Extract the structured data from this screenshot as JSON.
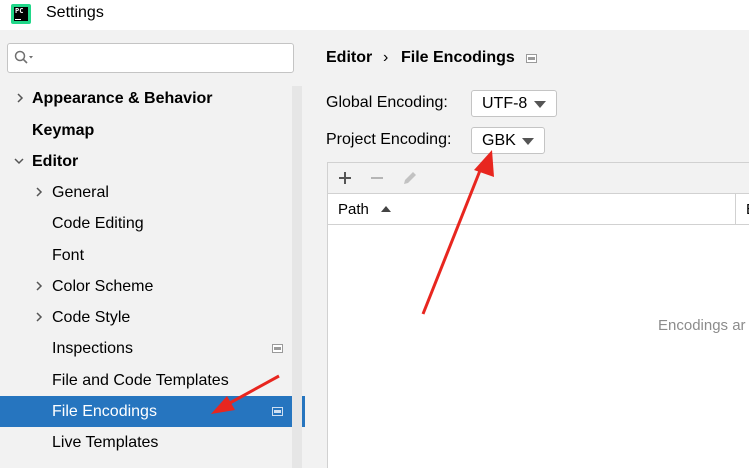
{
  "window": {
    "title": "Settings",
    "logo_text": "PC"
  },
  "sidebar": {
    "search": {
      "placeholder": ""
    },
    "items": [
      {
        "label": "Appearance & Behavior",
        "level": 0,
        "expandable": true,
        "expanded": false,
        "bold": true
      },
      {
        "label": "Keymap",
        "level": 0,
        "expandable": false,
        "bold": true
      },
      {
        "label": "Editor",
        "level": 0,
        "expandable": true,
        "expanded": true,
        "bold": true
      },
      {
        "label": "General",
        "level": 1,
        "expandable": true,
        "expanded": false
      },
      {
        "label": "Code Editing",
        "level": 1,
        "expandable": false
      },
      {
        "label": "Font",
        "level": 1,
        "expandable": false
      },
      {
        "label": "Color Scheme",
        "level": 1,
        "expandable": true,
        "expanded": false
      },
      {
        "label": "Code Style",
        "level": 1,
        "expandable": true,
        "expanded": false
      },
      {
        "label": "Inspections",
        "level": 1,
        "expandable": false,
        "project_icon": true
      },
      {
        "label": "File and Code Templates",
        "level": 1,
        "expandable": false
      },
      {
        "label": "File Encodings",
        "level": 1,
        "expandable": false,
        "selected": true,
        "project_icon": true
      },
      {
        "label": "Live Templates",
        "level": 1,
        "expandable": false
      }
    ]
  },
  "main": {
    "breadcrumb": {
      "parent": "Editor",
      "separator": "›",
      "current": "File Encodings"
    },
    "global_encoding": {
      "label": "Global Encoding:",
      "value": "UTF-8"
    },
    "project_encoding": {
      "label": "Project Encoding:",
      "value": "GBK"
    },
    "toolbar": {
      "add_icon": "plus-icon",
      "remove_icon": "minus-icon",
      "edit_icon": "pencil-icon"
    },
    "table": {
      "columns": [
        "Path",
        "E"
      ],
      "empty_text": "Encodings ar"
    }
  },
  "annotations": {
    "arrow_color": "#e8261f"
  },
  "colors": {
    "selection": "#2675bf",
    "background": "#f2f2f2"
  }
}
